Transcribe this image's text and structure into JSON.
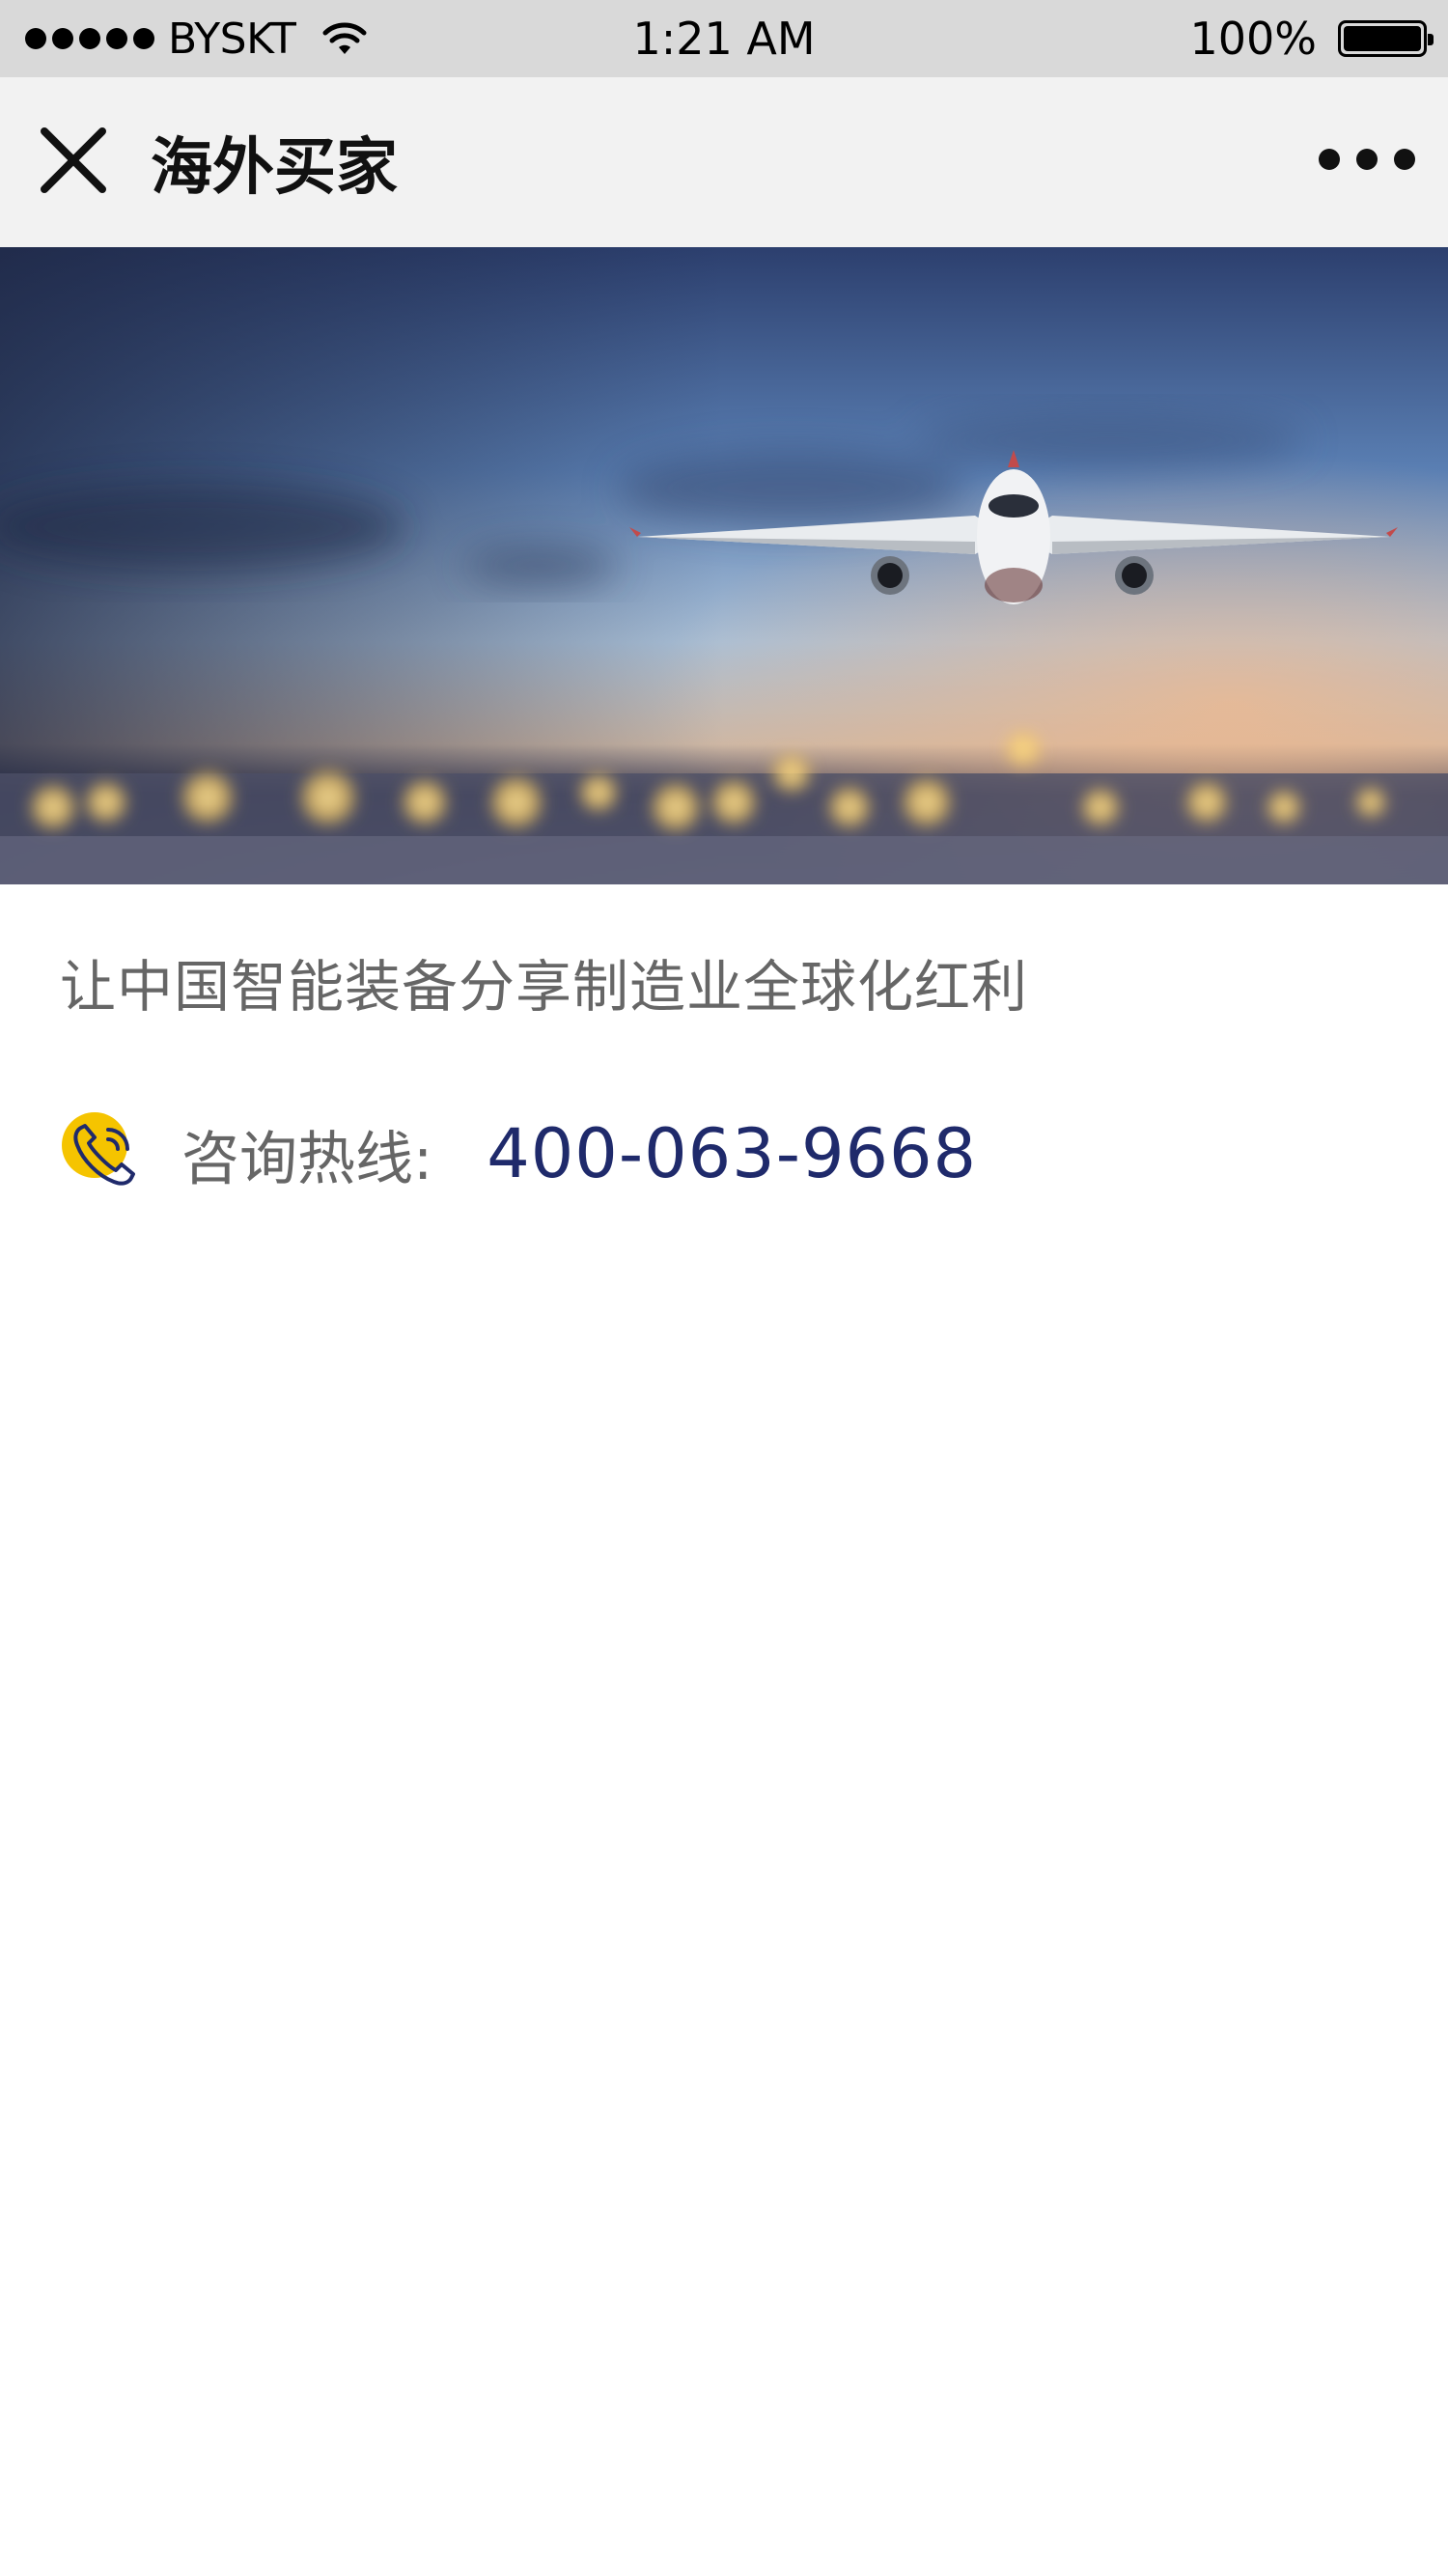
{
  "status_bar": {
    "carrier": "BYSKT",
    "time": "1:21 AM",
    "battery": "100%",
    "icons": [
      "signal-dots-icon",
      "wifi-icon",
      "battery-icon"
    ]
  },
  "nav": {
    "title": "海外买家",
    "close_icon": "close-icon",
    "more_icon": "more-icon"
  },
  "banner": {
    "image": "airplane-banner"
  },
  "content": {
    "slogan": "让中国智能装备分享制造业全球化红利",
    "hotline_label": "咨询热线:",
    "hotline_number": "400-063-9668"
  },
  "colors": {
    "status_bar_bg": "#d9d9d9",
    "nav_bg": "#f2f2f2",
    "text_gray": "#666666",
    "hotline_blue": "#1f2a6b",
    "icon_yellow": "#f5c400"
  }
}
